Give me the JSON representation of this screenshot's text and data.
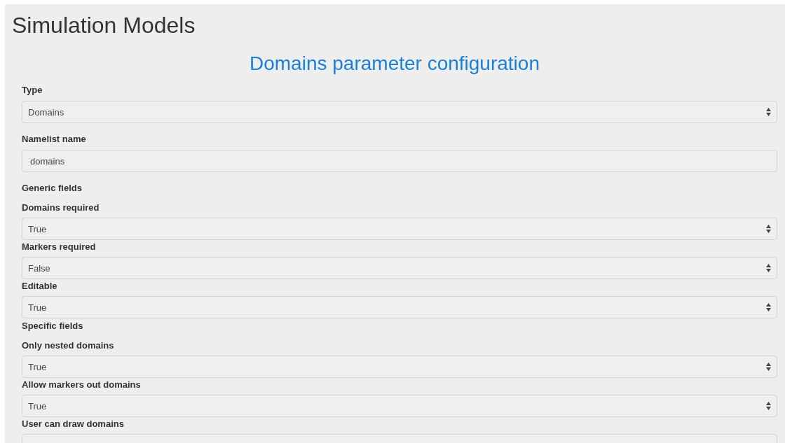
{
  "page_title": "Simulation Models",
  "form_title": "Domains parameter configuration",
  "fields": [
    {
      "label": "Type",
      "kind": "select",
      "value": "Domains"
    },
    {
      "label": "Namelist name",
      "kind": "input",
      "value": "domains"
    }
  ],
  "sections": [
    {
      "title": "Generic fields",
      "fields": [
        {
          "label": "Domains required",
          "kind": "select",
          "value": "True"
        },
        {
          "label": "Markers required",
          "kind": "select",
          "value": "False"
        },
        {
          "label": "Editable",
          "kind": "select",
          "value": "True"
        }
      ]
    },
    {
      "title": "Specific fields",
      "fields": [
        {
          "label": "Only nested domains",
          "kind": "select",
          "value": "True"
        },
        {
          "label": "Allow markers out domains",
          "kind": "select",
          "value": "True"
        },
        {
          "label": "User can draw domains",
          "kind": "select"
        }
      ]
    }
  ]
}
